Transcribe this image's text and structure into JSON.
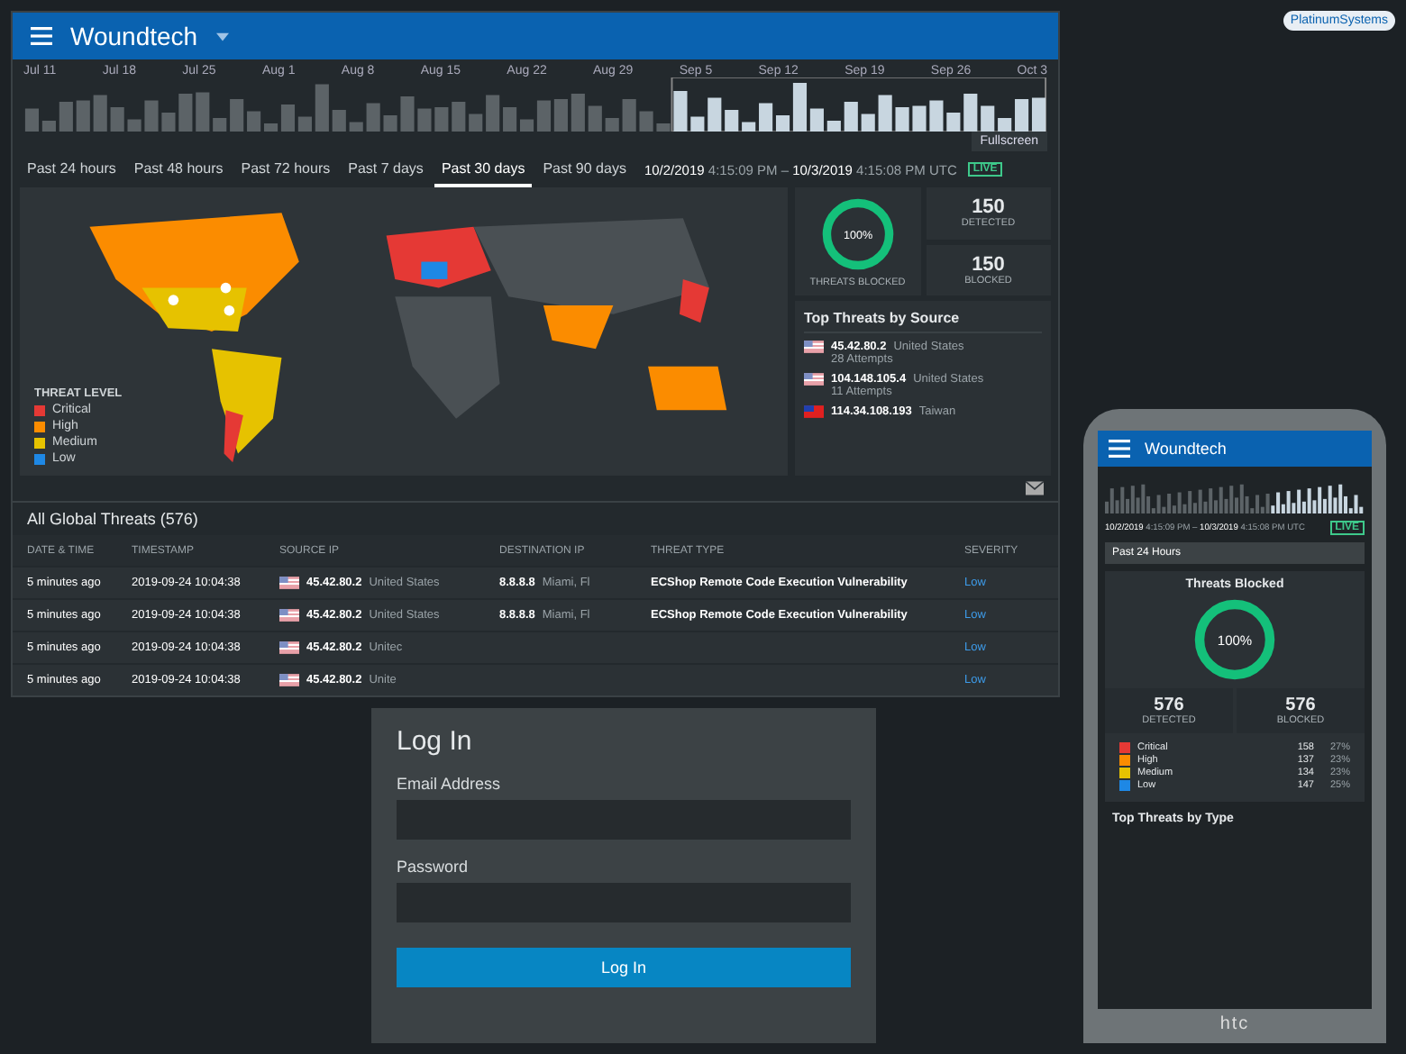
{
  "brand": {
    "logo_text": "PlatinumSystems"
  },
  "dashboard": {
    "title": "Woundtech",
    "timeline": {
      "labels": [
        "Jul 11",
        "Jul 18",
        "Jul 25",
        "Aug 1",
        "Aug 8",
        "Aug 15",
        "Aug 22",
        "Aug 29",
        "Sep 5",
        "Sep 12",
        "Sep 19",
        "Sep 26",
        "Oct 3"
      ],
      "fullscreen": "Fullscreen"
    },
    "tabs": [
      {
        "label": "Past 24 hours",
        "selected": false
      },
      {
        "label": "Past 48 hours",
        "selected": false
      },
      {
        "label": "Past 72 hours",
        "selected": false
      },
      {
        "label": "Past 7 days",
        "selected": false
      },
      {
        "label": "Past 30 days",
        "selected": true
      },
      {
        "label": "Past 90 days",
        "selected": false
      }
    ],
    "range": "**10/2/2019** 4:15:09 PM – **10/3/2019** 4:15:08 PM UTC",
    "live": "LIVE",
    "legend": {
      "title": "THREAT LEVEL",
      "items": [
        {
          "label": "Critical",
          "color": "#e53935"
        },
        {
          "label": "High",
          "color": "#fb8c00"
        },
        {
          "label": "Medium",
          "color": "#e6c200"
        },
        {
          "label": "Low",
          "color": "#1e88e5"
        }
      ]
    },
    "blocked": {
      "level": 1,
      "reading": "100%",
      "label": "THREATS BLOCKED"
    },
    "stats": [
      {
        "value": "150",
        "label": "DETECTED"
      },
      {
        "value": "150",
        "label": "BLOCKED"
      }
    ],
    "sources": {
      "title": "Top Threats by Source",
      "items": [
        {
          "kind": "us",
          "ip": "45.42.80.2",
          "country": "United States",
          "attempts": "28 Attempts"
        },
        {
          "kind": "us",
          "ip": "104.148.105.4",
          "country": "United States",
          "attempts": "11 Attempts"
        },
        {
          "kind": "tw",
          "ip": "114.34.108.193",
          "country": "Taiwan"
        }
      ]
    },
    "table": {
      "title": "All Global Threats (576)",
      "columns": [
        "DATE & TIME",
        "TIMESTAMP",
        "SOURCE IP",
        "DESTINATION IP",
        "THREAT TYPE",
        "SEVERITY"
      ],
      "rows": [
        {
          "date": "5 minutes ago",
          "timestamp": "2019-09-24 10:04:38",
          "kind": "us",
          "source_ip": "45.42.80.2",
          "source_country": "United States",
          "dest_ip": "8.8.8.8",
          "dest_city": "Miami, Fl",
          "threat": "ECShop Remote Code Execution Vulnerability",
          "severity": "Low"
        },
        {
          "date": "5 minutes ago",
          "timestamp": "2019-09-24 10:04:38",
          "kind": "us",
          "source_ip": "45.42.80.2",
          "source_country": "United States",
          "dest_ip": "8.8.8.8",
          "dest_city": "Miami, Fl",
          "threat": "ECShop Remote Code Execution Vulnerability",
          "severity": "Low"
        },
        {
          "date": "5 minutes ago",
          "timestamp": "2019-09-24 10:04:38",
          "kind": "us",
          "source_ip": "45.42.80.2",
          "source_country": "Unitec",
          "severity": "Low"
        },
        {
          "date": "5 minutes ago",
          "timestamp": "2019-09-24 10:04:38",
          "kind": "us",
          "source_ip": "45.42.80.2",
          "source_country": "Unite",
          "severity": "Low"
        }
      ]
    }
  },
  "login": {
    "title": "Log In",
    "fields": [
      {
        "label": "Email Address"
      },
      {
        "label": "Password"
      }
    ],
    "button": "Log In"
  },
  "phone": {
    "brand": "htc",
    "title": "Woundtech",
    "range": "**10/2/2019** 4:15:09 PM – **10/3/2019** 4:15:08 PM UTC",
    "live": "LIVE",
    "period": "Past 24 Hours",
    "blocked": {
      "title": "Threats Blocked",
      "level": 1,
      "reading": "100%"
    },
    "stats": [
      {
        "value": "576",
        "label": "DETECTED"
      },
      {
        "value": "576",
        "label": "BLOCKED"
      }
    ],
    "levels": [
      {
        "label": "Critical",
        "color": "#e53935",
        "count": "158",
        "pct": "27%"
      },
      {
        "label": "High",
        "color": "#fb8c00",
        "count": "137",
        "pct": "23%"
      },
      {
        "label": "Medium",
        "color": "#e6c200",
        "count": "134",
        "pct": "23%"
      },
      {
        "label": "Low",
        "color": "#1e88e5",
        "count": "147",
        "pct": "25%"
      }
    ],
    "next_title": "Top Threats by Type"
  }
}
